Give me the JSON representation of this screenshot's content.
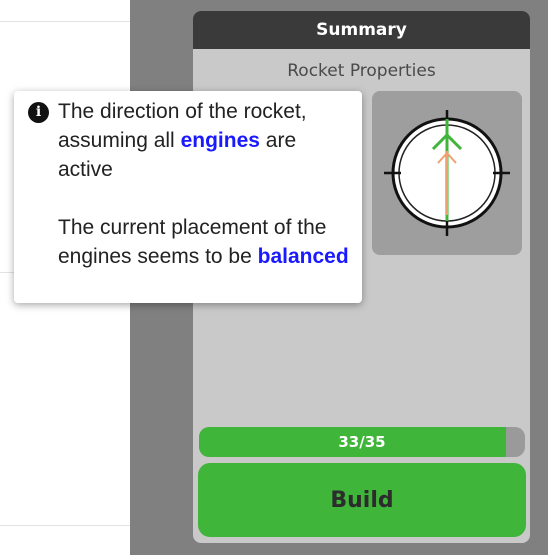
{
  "panel": {
    "title": "Summary",
    "subtitle": "Rocket Properties"
  },
  "progress": {
    "label": "33/35",
    "current": 33,
    "max": 35
  },
  "build_button": {
    "label": "Build"
  },
  "tooltip": {
    "icon": "info-icon",
    "line1_pre": "The direction of the rocket, assuming all",
    "line1_highlight": "engines",
    "line1_post": "are active",
    "line2_pre": "The current placement of the engines seems to be",
    "line2_highlight": "balanced"
  },
  "colors": {
    "accent_green": "#3fb53a",
    "highlight_blue": "#1a1aff",
    "header_dark": "#3a3a3a",
    "direction_arrow_orange": "#f0a070"
  }
}
